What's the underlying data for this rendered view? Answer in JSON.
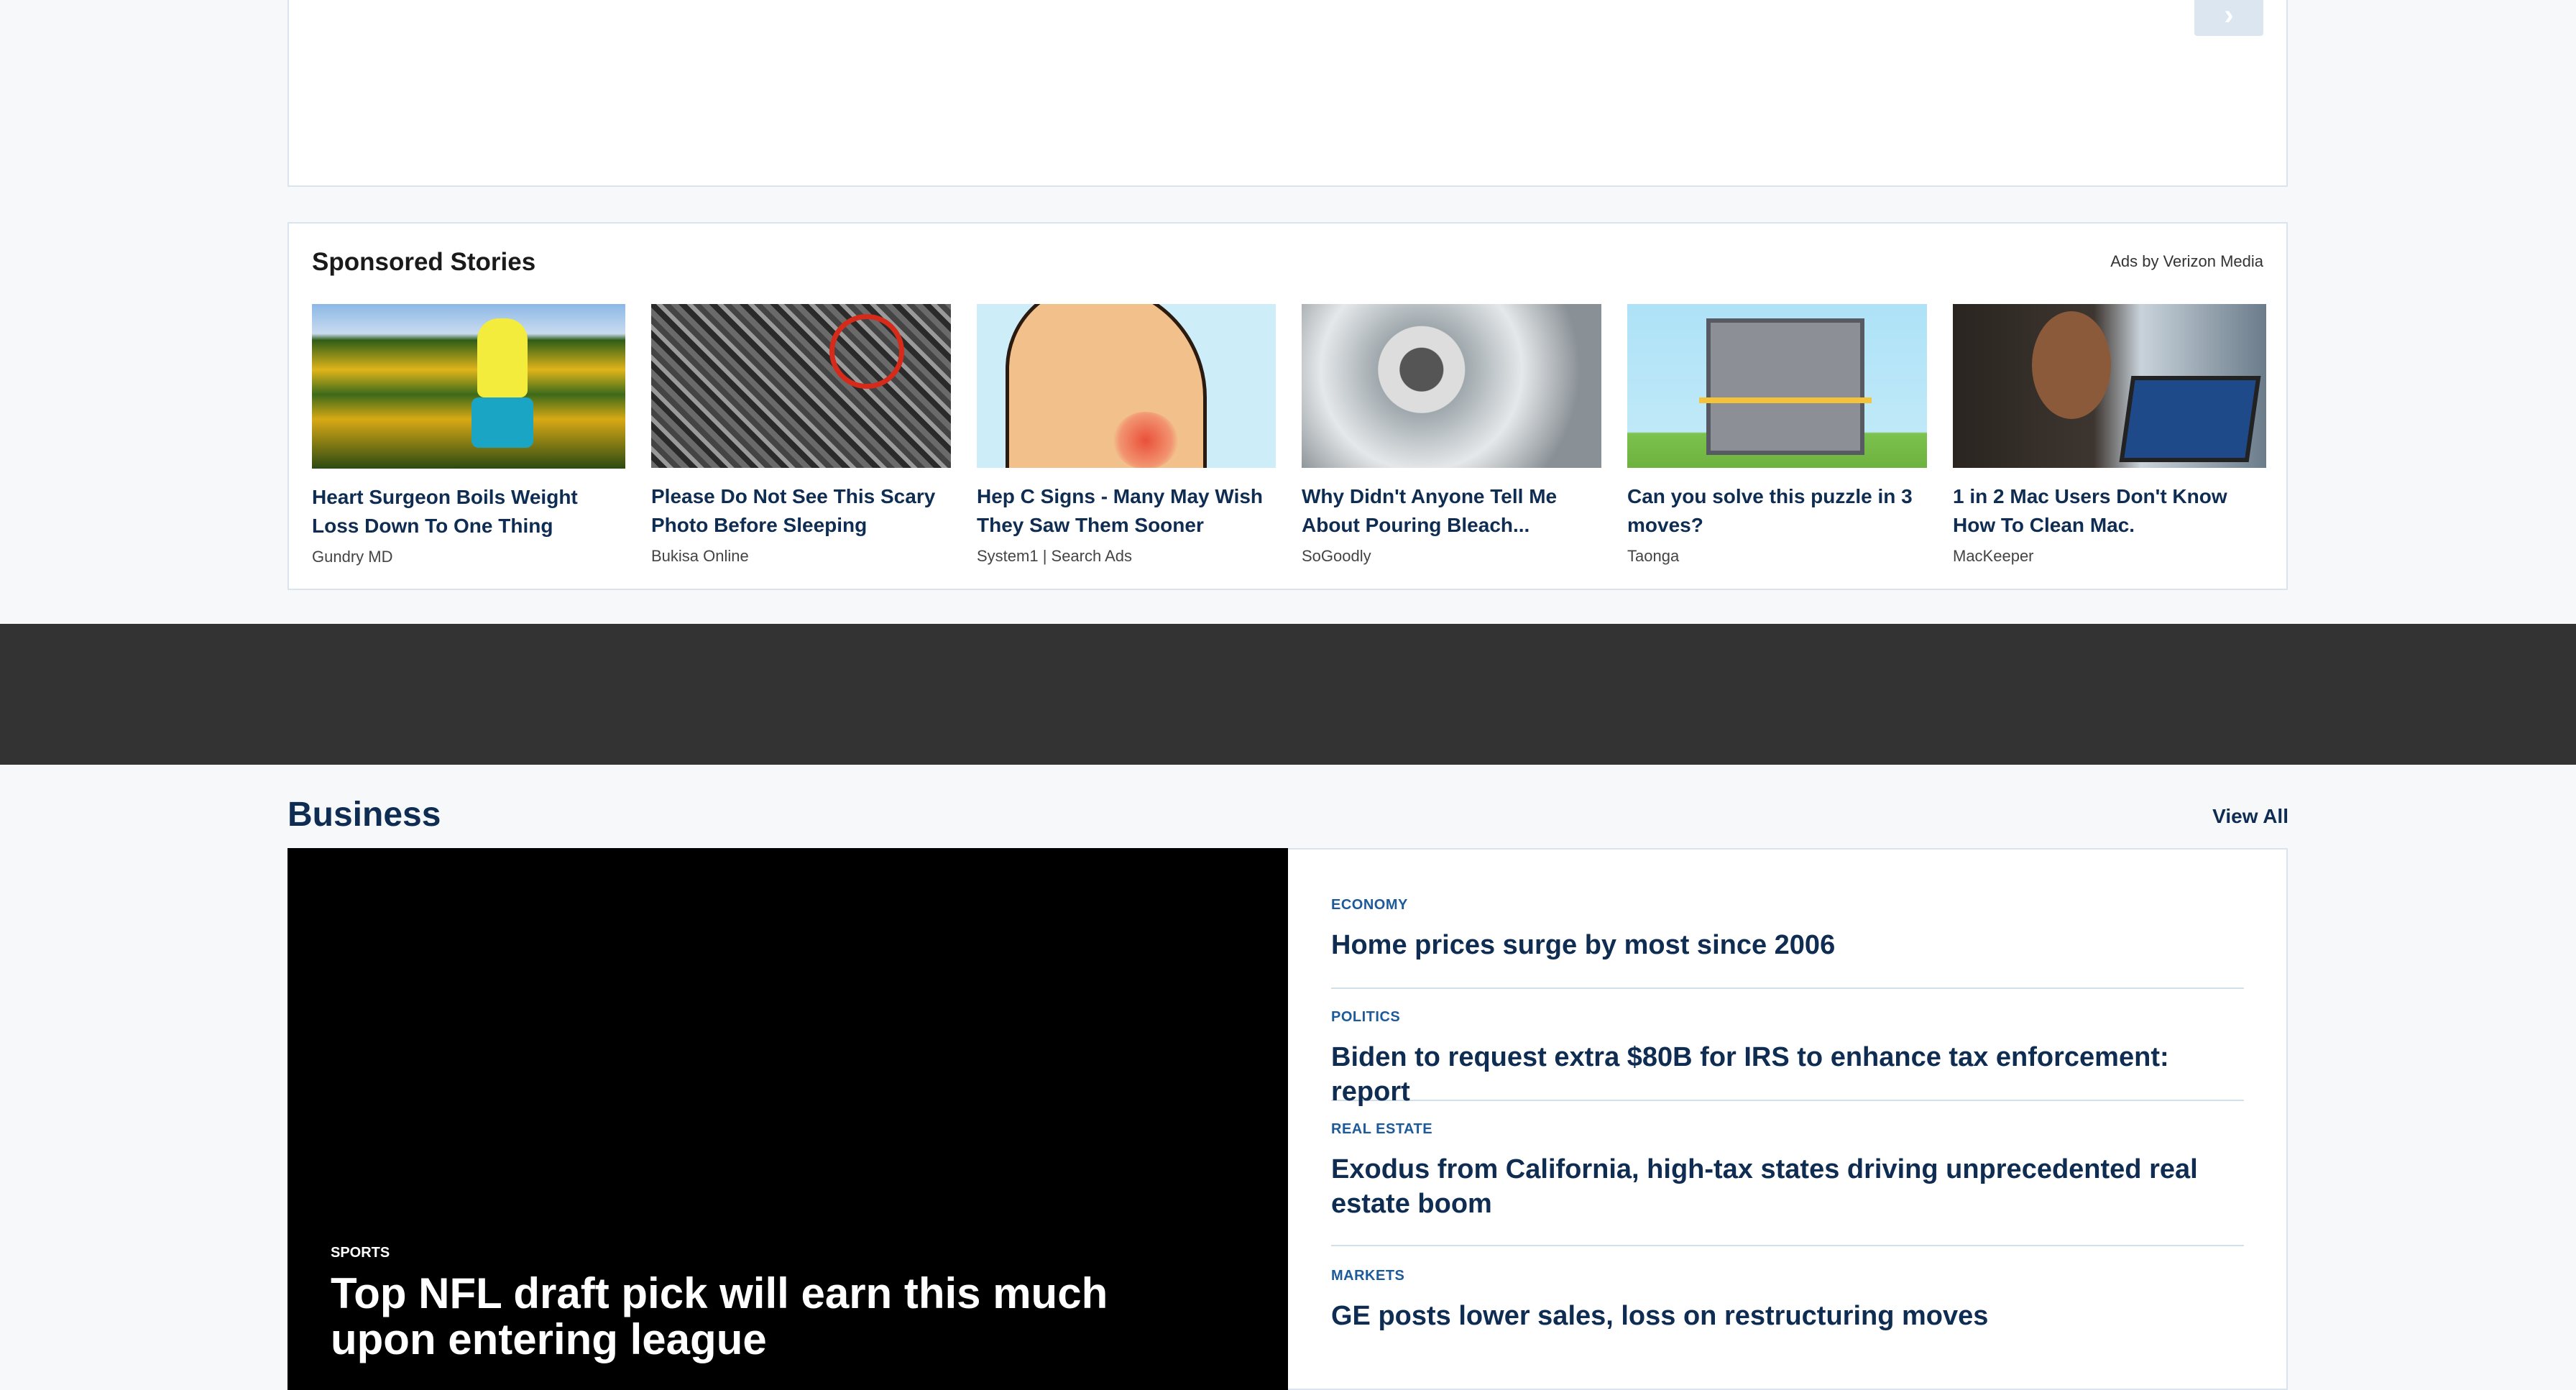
{
  "top_card": {
    "next_icon": "›"
  },
  "sponsored": {
    "title": "Sponsored Stories",
    "ads_by": "Ads by Verizon Media",
    "stories": [
      {
        "title": "Heart Surgeon Boils Weight Loss Down To One Thing",
        "source": "Gundry MD"
      },
      {
        "title": "Please Do Not See This Scary Photo Before Sleeping",
        "source": "Bukisa Online"
      },
      {
        "title": "Hep C Signs - Many May Wish They Saw Them Sooner",
        "source": "System1 | Search Ads"
      },
      {
        "title": "Why Didn't Anyone Tell Me About Pouring Bleach...",
        "source": "SoGoodly"
      },
      {
        "title": "Can you solve this puzzle in 3 moves?",
        "source": "Taonga"
      },
      {
        "title": "1 in 2 Mac Users Don't Know How To Clean Mac.",
        "source": "MacKeeper"
      }
    ]
  },
  "business": {
    "title": "Business",
    "view_all": "View All",
    "video": {
      "category": "SPORTS",
      "title": "Top NFL draft pick will earn this much upon entering league"
    },
    "articles": [
      {
        "category": "ECONOMY",
        "title": "Home prices surge by most since 2006"
      },
      {
        "category": "POLITICS",
        "title": "Biden to request extra $80B for IRS to enhance tax enforcement: report"
      },
      {
        "category": "REAL ESTATE",
        "title": "Exodus from California, high-tax states driving unprecedented real estate boom"
      },
      {
        "category": "MARKETS",
        "title": "GE posts lower sales, loss on restructuring moves"
      }
    ]
  },
  "colors": {
    "navy": "#0f2d52",
    "category_blue": "#1d5a9a",
    "dark_band": "#333333",
    "page_bg": "#f6f8fa"
  }
}
